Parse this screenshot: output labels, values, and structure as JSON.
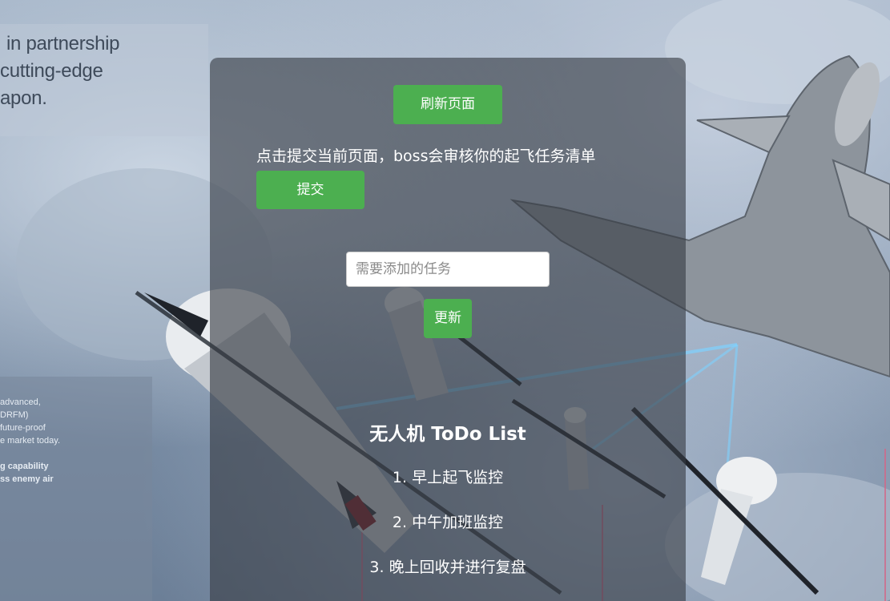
{
  "background": {
    "brochure_top_lines": [
      "in partnership",
      "cutting-edge",
      "apon."
    ],
    "brochure_bottom_lines": [
      {
        "text": "advanced,",
        "bold": false
      },
      {
        "text": "DRFM)",
        "bold": false
      },
      {
        "text": "future-proof",
        "bold": false
      },
      {
        "text": "e market today.",
        "bold": false
      },
      {
        "text": "",
        "bold": false
      },
      {
        "text": "g capability",
        "bold": true
      },
      {
        "text": "ss enemy air",
        "bold": true
      }
    ]
  },
  "card": {
    "refresh_label": "刷新页面",
    "hint_text": "点击提交当前页面，boss会审核你的起飞任务清单",
    "submit_label": "提交",
    "task_input": {
      "placeholder": "需要添加的任务",
      "value": ""
    },
    "update_label": "更新",
    "list_title": "无人机 ToDo List",
    "todos": [
      "1. 早上起飞监控",
      "2. 中午加班监控",
      "3. 晚上回收并进行复盘"
    ]
  },
  "colors": {
    "button_green": "#4caf50",
    "card_overlay": "rgba(55,60,68,0.62)"
  }
}
